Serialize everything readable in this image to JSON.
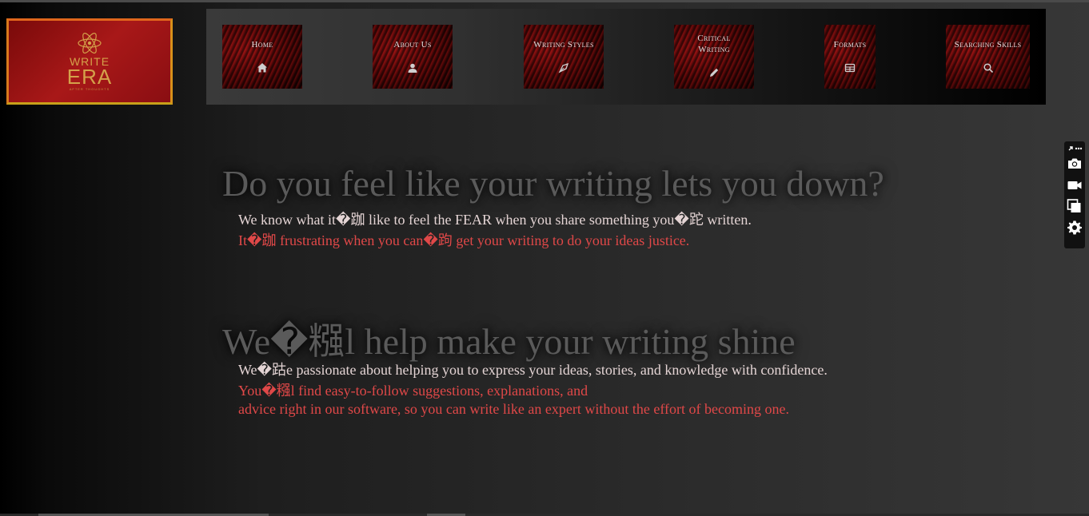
{
  "logo": {
    "line1": "WRITE",
    "line2": "ERA",
    "tagline": "AFTER THOUGHTS"
  },
  "nav": [
    {
      "label": "Home",
      "icon": "home-icon"
    },
    {
      "label": "About Us",
      "icon": "user-icon"
    },
    {
      "label": "Writing Styles",
      "icon": "pen-nib-icon"
    },
    {
      "label": "Critical Writing",
      "icon": "pencil-icon"
    },
    {
      "label": "Formats",
      "icon": "table-icon"
    },
    {
      "label": "Searching Skills",
      "icon": "search-icon"
    }
  ],
  "section1": {
    "heading": "Do you feel like your writing lets you down?",
    "line1": "We know what it�跏 like to feel the FEAR when you share something you�跎 written.",
    "line2": "It�跏 frustrating when you can�跔 get your writing to do your ideas justice."
  },
  "section2": {
    "heading": "We�糨l help make your writing shine",
    "line1": "We�跍e passionate about helping you to express your ideas, stories, and knowledge with confidence.",
    "line2": "You�糨l find easy-to-follow suggestions, explanations, and",
    "line3": "advice right in our software, so you can write like an expert without the effort of becoming one."
  },
  "side_toolbar": [
    "link-more-icon",
    "camera-icon",
    "video-icon",
    "copy-icon",
    "settings-icon"
  ],
  "colors": {
    "accent_red": "#e04848",
    "text_light": "#e4d4d4",
    "heading_gray": "#5a5a5a",
    "logo_gold": "#d4a14a"
  }
}
